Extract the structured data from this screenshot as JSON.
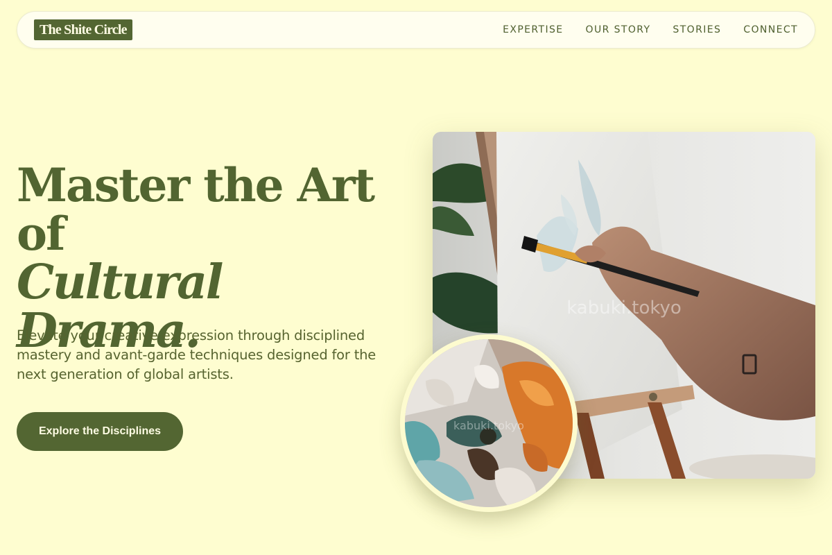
{
  "brand": {
    "name": "The Shite Circle",
    "color": "#536632"
  },
  "nav": {
    "items": [
      {
        "label": "EXPERTISE"
      },
      {
        "label": "OUR STORY"
      },
      {
        "label": "STORIES"
      },
      {
        "label": "CONNECT"
      }
    ]
  },
  "hero": {
    "headline_line1": "Master the Art",
    "headline_line2": "of",
    "headline_line3": "Cultural Drama.",
    "subtitle": "Elevate your creative expression through disciplined mastery and avant-garde techniques designed for the next generation of global artists.",
    "cta_label": "Explore the Disciplines"
  },
  "images": {
    "main_watermark": "kabuki.tokyo",
    "detail_watermark": "kabuki.tokyo"
  },
  "colors": {
    "background": "#fefdd0",
    "accent": "#536632",
    "text": "#56632f"
  }
}
